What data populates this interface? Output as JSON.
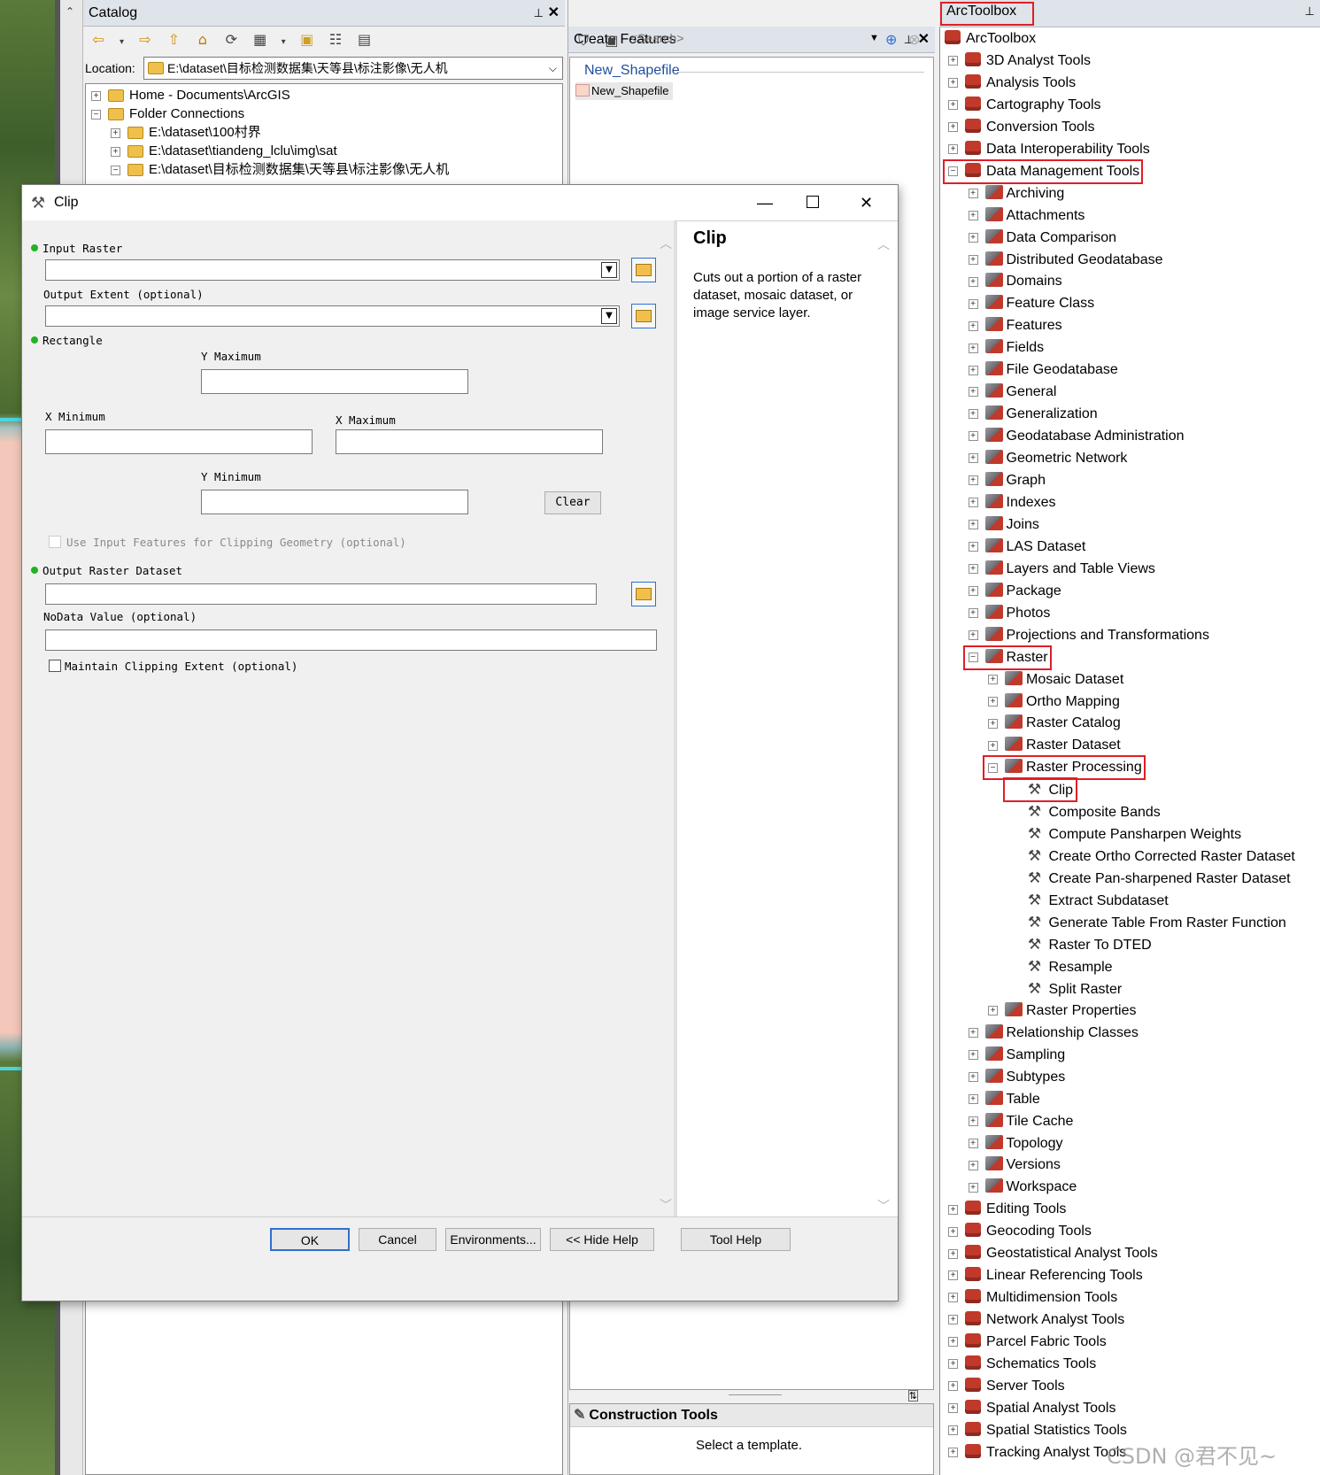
{
  "catalog": {
    "title": "Catalog",
    "location_label": "Location:",
    "location_value": "E:\\dataset\\目标检测数据集\\天等县\\标注影像\\无人机",
    "tree": [
      {
        "label": "Home - Documents\\ArcGIS",
        "indent": 0,
        "expander": "+"
      },
      {
        "label": "Folder Connections",
        "indent": 0,
        "expander": "−"
      },
      {
        "label": "E:\\dataset\\100村界",
        "indent": 1,
        "expander": "+"
      },
      {
        "label": "E:\\dataset\\tiandeng_lclu\\img\\sat",
        "indent": 1,
        "expander": "+"
      },
      {
        "label": "E:\\dataset\\目标检测数据集\\天等县\\标注影像\\无人机",
        "indent": 1,
        "expander": "−"
      }
    ]
  },
  "create_features": {
    "title": "Create Features",
    "search_placeholder": "<Search>",
    "layer_group": "New_Shapefile",
    "layer_item": "New_Shapefile",
    "construction_tools": "Construction Tools",
    "select_template": "Select a template."
  },
  "arctoolbox": {
    "title": "ArcToolbox",
    "root": "ArcToolbox",
    "toolboxes_top": [
      "3D Analyst Tools",
      "Analysis Tools",
      "Cartography Tools",
      "Conversion Tools",
      "Data Interoperability Tools",
      "Data Management Tools"
    ],
    "dm_toolsets_1": [
      "Archiving",
      "Attachments",
      "Data Comparison",
      "Distributed Geodatabase",
      "Domains",
      "Feature Class",
      "Features",
      "Fields",
      "File Geodatabase",
      "General",
      "Generalization",
      "Geodatabase Administration",
      "Geometric Network",
      "Graph",
      "Indexes",
      "Joins",
      "LAS Dataset",
      "Layers and Table Views",
      "Package",
      "Photos",
      "Projections and Transformations",
      "Raster"
    ],
    "raster_toolsets": [
      "Mosaic Dataset",
      "Ortho Mapping",
      "Raster Catalog",
      "Raster Dataset",
      "Raster Processing"
    ],
    "raster_processing_tools": [
      "Clip",
      "Composite Bands",
      "Compute Pansharpen Weights",
      "Create Ortho Corrected Raster Dataset",
      "Create Pan-sharpened Raster Dataset",
      "Extract Subdataset",
      "Generate Table From Raster Function",
      "Raster To DTED",
      "Resample",
      "Split Raster"
    ],
    "raster_toolsets_after": [
      "Raster Properties"
    ],
    "dm_toolsets_2": [
      "Relationship Classes",
      "Sampling",
      "Subtypes",
      "Table",
      "Tile Cache",
      "Topology",
      "Versions",
      "Workspace"
    ],
    "toolboxes_bottom": [
      "Editing Tools",
      "Geocoding Tools",
      "Geostatistical Analyst Tools",
      "Linear Referencing Tools",
      "Multidimension Tools",
      "Network Analyst Tools",
      "Parcel Fabric Tools",
      "Schematics Tools",
      "Server Tools",
      "Spatial Analyst Tools",
      "Spatial Statistics Tools",
      "Tracking Analyst Tools"
    ],
    "highlight_color": "#e01f26"
  },
  "clip_dialog": {
    "title": "Clip",
    "input_raster_label": "Input Raster",
    "output_extent_label": "Output Extent (optional)",
    "rectangle_label": "Rectangle",
    "y_max_label": "Y Maximum",
    "x_min_label": "X Minimum",
    "x_max_label": "X Maximum",
    "y_min_label": "Y Minimum",
    "clear_label": "Clear",
    "use_input_features_label": "Use Input Features for Clipping Geometry (optional)",
    "output_raster_label": "Output Raster Dataset",
    "nodata_label": "NoData Value (optional)",
    "maintain_extent_label": "Maintain Clipping Extent (optional)",
    "help_title": "Clip",
    "help_text": "Cuts out a portion of a raster dataset, mosaic dataset, or image service layer.",
    "buttons": {
      "ok": "OK",
      "cancel": "Cancel",
      "environments": "Environments...",
      "hide_help": "<< Hide Help",
      "tool_help": "Tool Help"
    },
    "required_color": "#21b321"
  },
  "watermark": "CSDN @君不见~"
}
